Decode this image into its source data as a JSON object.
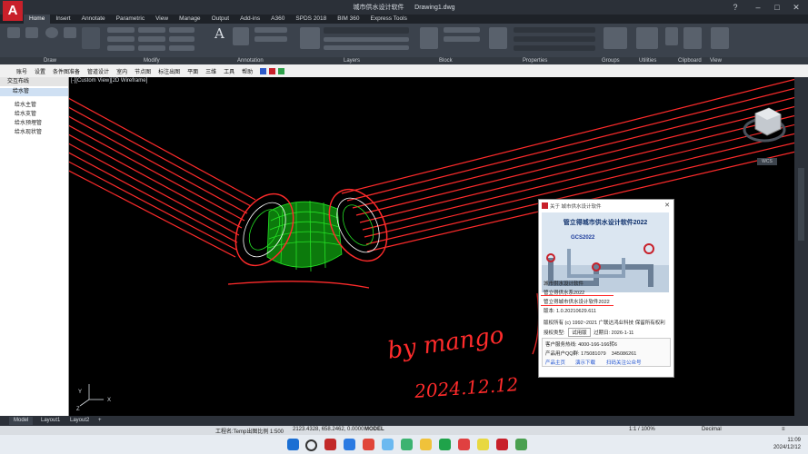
{
  "window": {
    "title": "城市供水设计软件",
    "doc": "Drawing1.dwg"
  },
  "ribbon_tabs": [
    "Home",
    "Insert",
    "Annotate",
    "Parametric",
    "View",
    "Manage",
    "Output",
    "Add-ins",
    "A360",
    "SPDS 2018",
    "BIM 360",
    "Express Tools"
  ],
  "panel_labels": {
    "draw": "Draw",
    "modify": "Modify",
    "annotation": "Annotation",
    "layers": "Layers",
    "block": "Block",
    "properties": "Properties",
    "groups": "Groups",
    "utilities": "Utilities",
    "clipboard": "Clipboard",
    "view": "View"
  },
  "menu": [
    "账号",
    "设置",
    "条件图准备",
    "管道设计",
    "室内",
    "节点图",
    "标注出图",
    "平面",
    "三维",
    "工具",
    "帮助"
  ],
  "left_panel": {
    "title": "交互布线",
    "group": "给水管",
    "items": [
      "给水主管",
      "给水支管",
      "给水预埋管",
      "给水现状管"
    ]
  },
  "viewport": {
    "label": "[-][Custom View][2D Wireframe]",
    "viewcube_label": "WCS"
  },
  "handwriting": {
    "line1": "by mango",
    "line2": "2024.12.12"
  },
  "dialog": {
    "title": "关于 城市供水设计软件",
    "banner_title": "管立得城市供水设计软件2022",
    "banner_badge": "GCS2022",
    "app_name": "城市供水设计软件",
    "product1": "管立得供水系2022",
    "product2": "管立得城市供水设计软件2022",
    "version": "版本: 1.0.20210629.611",
    "copyright": "版权所有 (c) 1992~2021 广联达鸿业科技 保留所有权利",
    "license_label": "授权类型:",
    "license_type": "试用版",
    "expire_label": "过期日:",
    "expire_date": "2026-1-11",
    "hotline_label": "客户服务热线:",
    "hotline": "4000-166-166转6",
    "qq_label": "产品用户QQ群:",
    "qq1": "175081079",
    "qq2": "345086261",
    "link_home": "产品主页",
    "link_download": "演示下载",
    "link_wechat": "扫码关注公众号"
  },
  "layout_tabs": [
    "Model",
    "Layout1",
    "Layout2"
  ],
  "status": {
    "scale": "工程名:Temp出图比例 1:500",
    "coords": "2123.4328, 658.2462, 0.0000",
    "mode": "MODEL",
    "annoscale": "1:1 / 100%",
    "units": "Decimal"
  },
  "taskbar": {
    "time": "11:09",
    "date": "2024/12/12"
  },
  "colors": {
    "pipe": "#ff2b2b",
    "elbow": "#25e025",
    "accent": "#c8202a",
    "link": "#1a4fd0"
  }
}
